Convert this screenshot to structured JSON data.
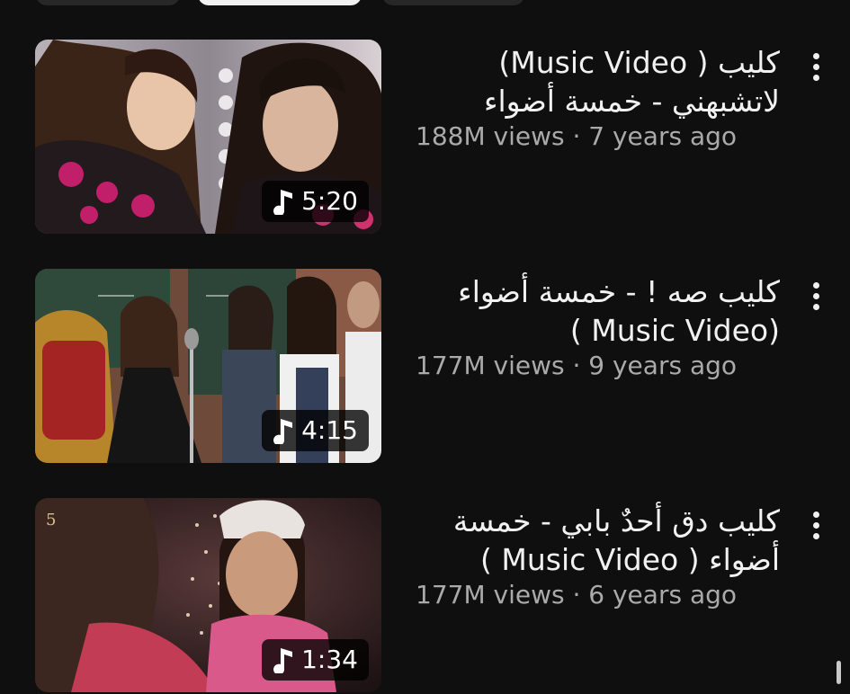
{
  "videos": [
    {
      "title_line1": "كليب ( Music Video)",
      "title_line2": "لاتشبهني - خمسة أضواء",
      "meta": "188M views · 7 years ago",
      "duration": "5:20",
      "thumbnail_icon": "music-note-icon"
    },
    {
      "title_line1": "كليب صه ! - خمسة أضواء",
      "title_line2": "( Music Video)",
      "meta": "177M views · 9 years ago",
      "duration": "4:15",
      "thumbnail_icon": "music-note-icon"
    },
    {
      "title_line1": "كليب دق أحدٌ بابي - خمسة",
      "title_line2": "أضواء ( Music Video )",
      "meta": "177M views · 6 years ago",
      "duration": "1:34",
      "thumbnail_icon": "music-note-icon"
    }
  ],
  "more_icon": "more-vert-icon",
  "colors": {
    "background": "#0f0f0f",
    "title": "#f1f1f1",
    "meta": "#aaaaaa",
    "badge": "#000000"
  }
}
